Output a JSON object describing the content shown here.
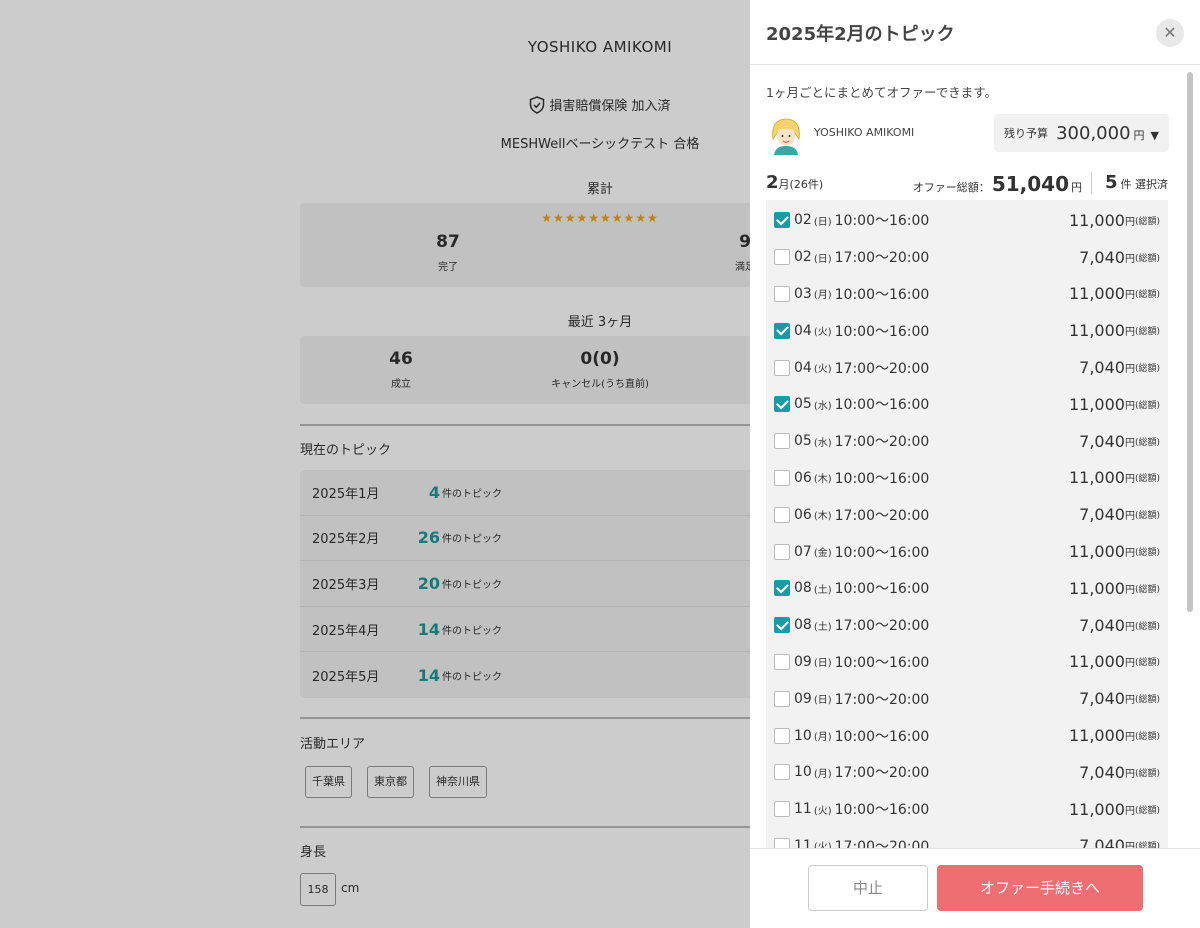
{
  "profile": {
    "name": "YOSHIKO AMIKOMI",
    "insurance": "損害賠償保険 加入済",
    "test": "MESHWellベーシックテスト 合格",
    "cumulative": {
      "title": "累計",
      "stars": "★★★★★★★★★★",
      "completed_num": "87",
      "completed_label": "完了",
      "satisfaction_num": "9",
      "satisfaction_label": "満足"
    },
    "recent": {
      "title": "最近 3ヶ月",
      "success_num": "46",
      "success_label": "成立",
      "cancel_num": "0(0)",
      "cancel_label": "キャンセル(うち直前)"
    },
    "topics_title": "現在のトピック",
    "topics": [
      {
        "month": "2025年1月",
        "count": "4",
        "suffix": "件のトピック"
      },
      {
        "month": "2025年2月",
        "count": "26",
        "suffix": "件のトピック"
      },
      {
        "month": "2025年3月",
        "count": "20",
        "suffix": "件のトピック"
      },
      {
        "month": "2025年4月",
        "count": "14",
        "suffix": "件のトピック"
      },
      {
        "month": "2025年5月",
        "count": "14",
        "suffix": "件のトピック"
      }
    ],
    "area_title": "活動エリア",
    "areas": [
      "千葉県",
      "東京都",
      "神奈川県"
    ],
    "height_title": "身長",
    "height_value": "158",
    "height_unit": "cm"
  },
  "panel": {
    "title": "2025年2月のトピック",
    "close_icon": "close-icon",
    "description": "1ヶ月ごとにまとめてオファーできます。",
    "user_name": "YOSHIKO AMIKOMI",
    "budget_label": "残り予算",
    "budget_value": "300,000",
    "budget_yen": "円",
    "month_num": "2",
    "month_suffix": "月(26件)",
    "total_label": "オファー総額：",
    "total_value": "51,040",
    "total_yen": "円",
    "selected_count": "5",
    "selected_suffix": "件 選択済",
    "price_yen": "円",
    "price_total": "(総額)",
    "slots": [
      {
        "day": "02",
        "dow": "(日)",
        "time": "10:00～16:00",
        "price": "11,000",
        "checked": true
      },
      {
        "day": "02",
        "dow": "(日)",
        "time": "17:00～20:00",
        "price": "7,040",
        "checked": false
      },
      {
        "day": "03",
        "dow": "(月)",
        "time": "10:00～16:00",
        "price": "11,000",
        "checked": false
      },
      {
        "day": "04",
        "dow": "(火)",
        "time": "10:00～16:00",
        "price": "11,000",
        "checked": true
      },
      {
        "day": "04",
        "dow": "(火)",
        "time": "17:00～20:00",
        "price": "7,040",
        "checked": false
      },
      {
        "day": "05",
        "dow": "(水)",
        "time": "10:00～16:00",
        "price": "11,000",
        "checked": true
      },
      {
        "day": "05",
        "dow": "(水)",
        "time": "17:00～20:00",
        "price": "7,040",
        "checked": false
      },
      {
        "day": "06",
        "dow": "(木)",
        "time": "10:00～16:00",
        "price": "11,000",
        "checked": false
      },
      {
        "day": "06",
        "dow": "(木)",
        "time": "17:00～20:00",
        "price": "7,040",
        "checked": false
      },
      {
        "day": "07",
        "dow": "(金)",
        "time": "10:00～16:00",
        "price": "11,000",
        "checked": false
      },
      {
        "day": "08",
        "dow": "(土)",
        "time": "10:00～16:00",
        "price": "11,000",
        "checked": true
      },
      {
        "day": "08",
        "dow": "(土)",
        "time": "17:00～20:00",
        "price": "7,040",
        "checked": true
      },
      {
        "day": "09",
        "dow": "(日)",
        "time": "10:00～16:00",
        "price": "11,000",
        "checked": false
      },
      {
        "day": "09",
        "dow": "(日)",
        "time": "17:00～20:00",
        "price": "7,040",
        "checked": false
      },
      {
        "day": "10",
        "dow": "(月)",
        "time": "10:00～16:00",
        "price": "11,000",
        "checked": false
      },
      {
        "day": "10",
        "dow": "(月)",
        "time": "17:00～20:00",
        "price": "7,040",
        "checked": false
      },
      {
        "day": "11",
        "dow": "(火)",
        "time": "10:00～16:00",
        "price": "11,000",
        "checked": false
      },
      {
        "day": "11",
        "dow": "(火)",
        "time": "17:00～20:00",
        "price": "7,040",
        "checked": false
      }
    ],
    "cancel_label": "中止",
    "offer_label": "オファー手続きへ",
    "colors": {
      "accent": "#1a9aa6",
      "offer": "#ee6e72",
      "topic_count": "#1a9a96",
      "stars": "#f0a500"
    }
  }
}
